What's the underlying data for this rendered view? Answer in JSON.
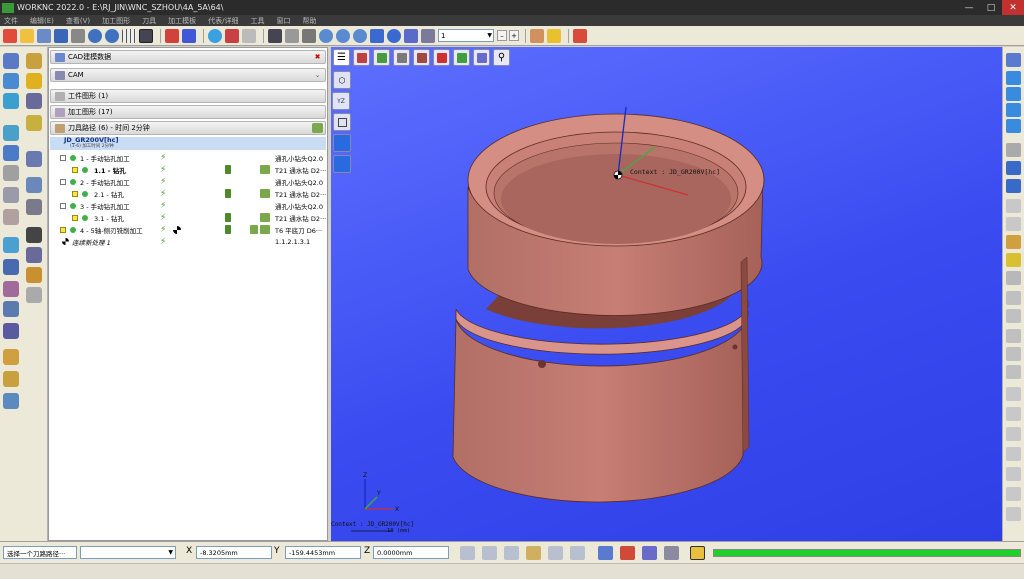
{
  "window": {
    "title": "WORKNC 2022.0 - E:\\RJ_JIN\\WNC_SZHOU\\4A_5A\\64\\"
  },
  "menu": [
    "文件",
    "编辑(E)",
    "查看(V)",
    "加工图形",
    "刀具",
    "加工模板",
    "代表/详细",
    "工具",
    "窗口",
    "帮助"
  ],
  "toolbar": {
    "view_combo_value": "1"
  },
  "panels": {
    "cad": {
      "label": "CAD建模数据"
    },
    "cam": {
      "label": "CAM"
    },
    "work_geometry": {
      "label": "工件图形  (1)"
    },
    "machining_geometry": {
      "label": "加工图形  (17)"
    },
    "toolpaths": {
      "label": "刀具路径  (6) - 时间  2分钟"
    }
  },
  "tree": {
    "rows": [
      {
        "name": "JD_GR200V[hc]",
        "sub": "(1-6) 加工时间 2分钟",
        "desc": ""
      },
      {
        "name": "1 - 手动钻孔加工",
        "desc": "通孔小钻头Q2.0"
      },
      {
        "name": "1.1 - 钻孔",
        "desc": "T21 通水钻 D2···"
      },
      {
        "name": "2 - 手动钻孔加工",
        "desc": "通孔小钻头Q2.0"
      },
      {
        "name": "2.1 - 钻孔",
        "desc": "T21 通水钻 D2···"
      },
      {
        "name": "3 - 手动钻孔加工",
        "desc": "通孔小钻头Q2.0"
      },
      {
        "name": "3.1 - 钻孔",
        "desc": "T21 通水钻 D2···"
      },
      {
        "name": "4 - 5轴-侧刃铣削加工",
        "desc": "T6 平底刀 D6···"
      },
      {
        "name": "连续新处理 1",
        "desc": "1.1.2.1.3.1"
      }
    ]
  },
  "viewport": {
    "context_label": "Context : JD_GR200V[hc]",
    "context_bottom": "Context : JD_GR200V[hc]",
    "scale_label": "10 (mm)",
    "axes": {
      "x": "X",
      "y": "Y",
      "z": "Z"
    },
    "model_color": "#c77e74",
    "background_color": "#3a4cf0"
  },
  "status": {
    "prompt": "选择一个刀路路径···",
    "x_label": "X",
    "x_value": "-8.3205mm",
    "y_label": "Y",
    "y_value": "-159.4453mm",
    "z_label": "Z",
    "z_value": "0.0000mm",
    "progress": 1.0
  }
}
